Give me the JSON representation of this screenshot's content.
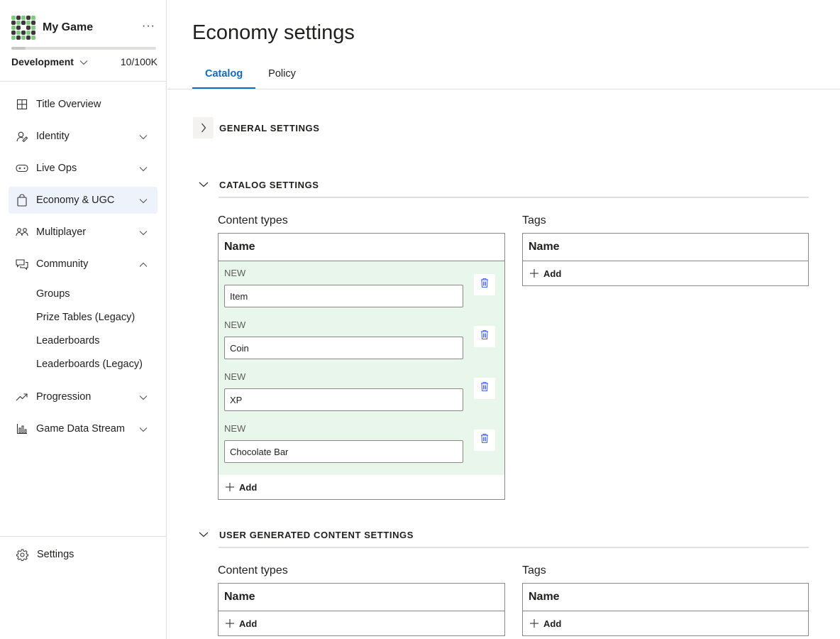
{
  "app": {
    "name": "My Game",
    "more_label": "···",
    "environment": "Development",
    "usage": "10/100K",
    "usage_fraction": 0.1
  },
  "sidebar": {
    "items": [
      {
        "label": "Title Overview",
        "icon": "grid-icon"
      },
      {
        "label": "Identity",
        "icon": "identity-icon"
      },
      {
        "label": "Live Ops",
        "icon": "gamepad-icon"
      },
      {
        "label": "Economy & UGC",
        "icon": "shopping-bag-icon"
      },
      {
        "label": "Multiplayer",
        "icon": "people-icon"
      },
      {
        "label": "Community",
        "icon": "chat-icon"
      },
      {
        "label": "Progression",
        "icon": "trending-icon"
      },
      {
        "label": "Game Data Stream",
        "icon": "bar-chart-icon"
      }
    ],
    "community_subitems": [
      "Groups",
      "Prize Tables (Legacy)",
      "Leaderboards",
      "Leaderboards (Legacy)"
    ],
    "settings_label": "Settings"
  },
  "page": {
    "title": "Economy settings",
    "tabs": [
      "Catalog",
      "Policy"
    ]
  },
  "sections": {
    "general": {
      "title": "GENERAL SETTINGS"
    },
    "catalog": {
      "title": "CATALOG SETTINGS",
      "content_types_label": "Content types",
      "tags_label": "Tags",
      "column_header": "Name",
      "content_types": [
        {
          "status": "NEW",
          "value": "Item"
        },
        {
          "status": "NEW",
          "value": "Coin"
        },
        {
          "status": "NEW",
          "value": "XP"
        },
        {
          "status": "NEW",
          "value": "Chocolate Bar"
        }
      ],
      "add_label": "Add"
    },
    "ugc": {
      "title": "USER GENERATED CONTENT SETTINGS",
      "content_types_label": "Content types",
      "tags_label": "Tags",
      "column_header": "Name",
      "add_label": "Add"
    }
  },
  "colors": {
    "accent": "#0f6cbd",
    "new_row_bg": "#e8f6ec",
    "active_nav_bg": "#eef3fb",
    "delete_icon": "#4f6bed"
  }
}
